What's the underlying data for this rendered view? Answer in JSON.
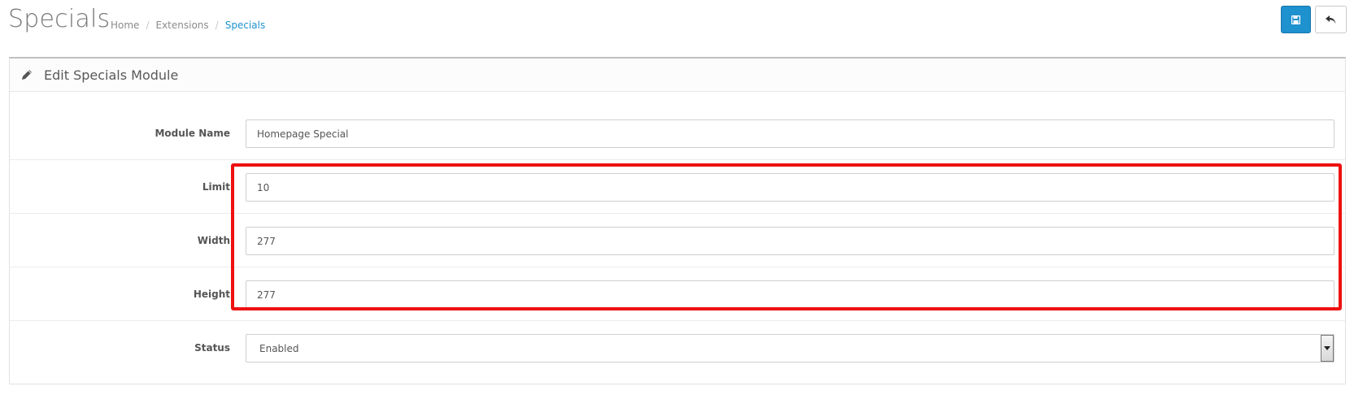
{
  "page": {
    "title": "Specials"
  },
  "breadcrumb": {
    "items": [
      {
        "label": "Home"
      },
      {
        "label": "Extensions"
      },
      {
        "label": "Specials"
      }
    ],
    "separator": "/"
  },
  "toolbar": {
    "save_icon": "save-icon",
    "back_icon": "reply-icon",
    "save_color": "#1e91cf"
  },
  "panel": {
    "heading_icon": "pencil-icon",
    "heading": "Edit Specials Module"
  },
  "form": {
    "module_name": {
      "label": "Module Name",
      "value": "Homepage Special"
    },
    "limit": {
      "label": "Limit",
      "value": "10"
    },
    "width": {
      "label": "Width",
      "value": "277"
    },
    "height": {
      "label": "Height",
      "value": "277"
    },
    "status": {
      "label": "Status",
      "value": "Enabled"
    }
  },
  "annotation": {
    "highlight_color": "#ee1111"
  }
}
